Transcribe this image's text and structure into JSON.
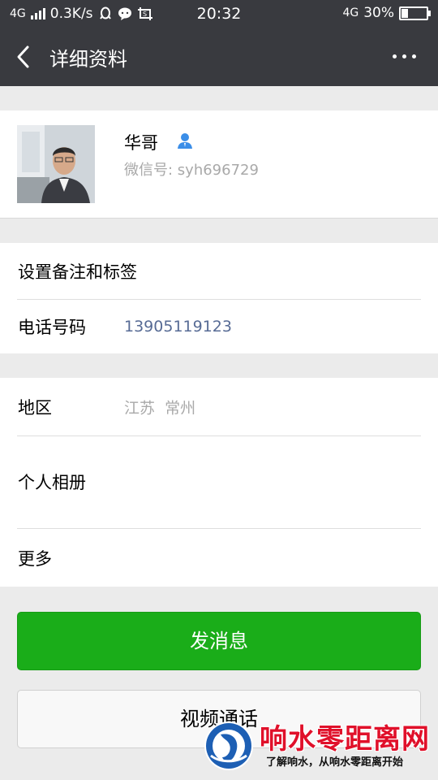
{
  "status_bar": {
    "network_left": "4G",
    "speed": "0.3K/s",
    "time": "20:32",
    "network_right": "4G",
    "battery": "30%",
    "battery_level": 0.3,
    "icons": [
      "signal-icon",
      "qq-icon",
      "chat-bubble-icon",
      "screenshot-icon",
      "battery-icon"
    ]
  },
  "nav": {
    "title": "详细资料",
    "back_icon": "back-chevron-icon",
    "more_icon": "more-dots-icon"
  },
  "profile": {
    "name": "华哥",
    "wechat_id": "微信号: syh696729",
    "verified_icon": "person-icon"
  },
  "group1": {
    "remark_label": "设置备注和标签",
    "phone_label": "电话号码",
    "phone_value": "13905119123"
  },
  "group2": {
    "region_label": "地区",
    "region_value": "江苏  常州",
    "album_label": "个人相册",
    "more_label": "更多"
  },
  "actions": {
    "send_message": "发消息",
    "video_call": "视频通话"
  },
  "watermark": {
    "title": "响水零距离网",
    "subtitle": "了解响水，从响水零距离开始"
  },
  "colors": {
    "header_bg": "#393a3f",
    "send_button": "#1aad19",
    "phone_link": "#576b95",
    "secondary_text": "#a9a9a9",
    "watermark_red": "#e0102a"
  }
}
